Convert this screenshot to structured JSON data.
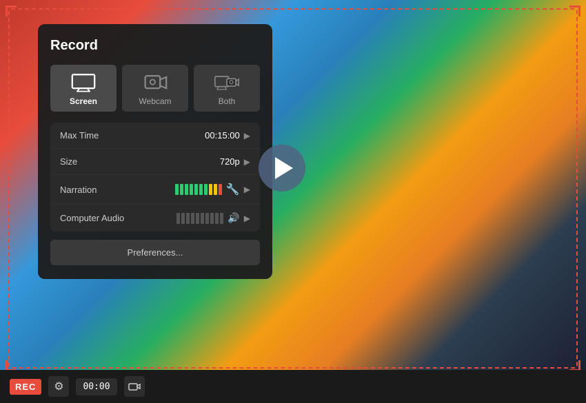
{
  "panel": {
    "title": "Record",
    "sources": [
      {
        "id": "screen",
        "label": "Screen",
        "active": true
      },
      {
        "id": "webcam",
        "label": "Webcam",
        "active": false
      },
      {
        "id": "both",
        "label": "Both",
        "active": false
      }
    ],
    "settings": [
      {
        "id": "max-time",
        "label": "Max Time",
        "value": "00:15:00"
      },
      {
        "id": "size",
        "label": "Size",
        "value": "720p"
      },
      {
        "id": "narration",
        "label": "Narration",
        "value": ""
      },
      {
        "id": "computer-audio",
        "label": "Computer Audio",
        "value": ""
      }
    ],
    "preferences_label": "Preferences..."
  },
  "toolbar": {
    "rec_label": "REC",
    "time": "00:00",
    "settings_icon": "⚙",
    "camera_icon": "🎥"
  },
  "colors": {
    "accent": "#e74c3c",
    "panel_bg": "#1e1e1e",
    "active_source": "#4a4a4a"
  }
}
